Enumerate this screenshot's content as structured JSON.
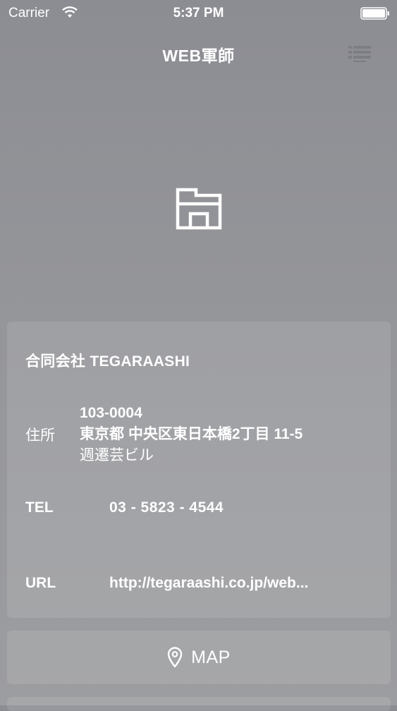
{
  "status_bar": {
    "carrier": "Carrier",
    "time": "5:37 PM",
    "icons": [
      "wifi-icon",
      "battery-icon"
    ]
  },
  "nav": {
    "title": "WEB軍師",
    "menu_icon": "list-icon"
  },
  "hero": {
    "icon": "store-icon"
  },
  "company": {
    "name": "合同会社 TEGARAASHI",
    "address_label": "住所",
    "address_lines": [
      "103-0004",
      "東京都 中央区東日本橋2丁目 11-5",
      "週遷芸ビル"
    ],
    "tel_label": "TEL",
    "tel_value": "03 - 5823 - 4544",
    "url_label": "URL",
    "url_value": "http://tegaraashi.co.jp/web..."
  },
  "map_button": {
    "icon": "map-pin-icon",
    "label": "MAP"
  },
  "colors": {
    "background_top": "#8c8d93",
    "background_bottom": "#9c9da0",
    "text": "#ffffff"
  }
}
